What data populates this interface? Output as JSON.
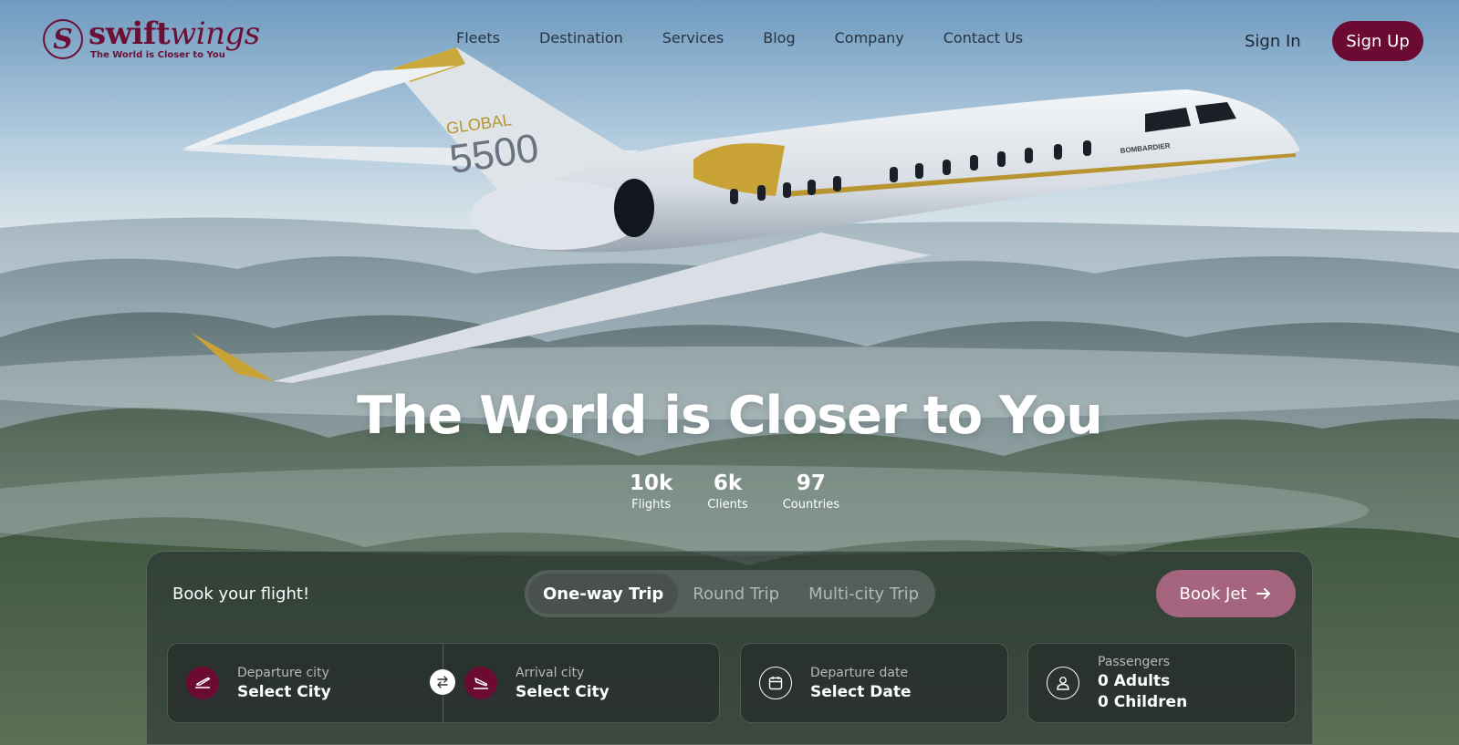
{
  "brand": {
    "name_part1": "swift",
    "name_part2": "wings",
    "tagline": "The World is Closer to You",
    "mark": "S",
    "color": "#6b0a33"
  },
  "nav": {
    "items": [
      "Fleets",
      "Destination",
      "Services",
      "Blog",
      "Company",
      "Contact Us"
    ]
  },
  "auth": {
    "sign_in": "Sign In",
    "sign_up": "Sign Up"
  },
  "hero": {
    "headline": "The World is Closer to You",
    "aircraft_model_line1": "GLOBAL",
    "aircraft_model_line2": "5500",
    "aircraft_brand": "BOMBARDIER",
    "stats": [
      {
        "value": "10k",
        "label": "Flights"
      },
      {
        "value": "6k",
        "label": "Clients"
      },
      {
        "value": "97",
        "label": "Countries"
      }
    ]
  },
  "booking": {
    "title": "Book your flight!",
    "trip_types": [
      "One-way Trip",
      "Round Trip",
      "Multi-city Trip"
    ],
    "active_trip_type": "One-way Trip",
    "book_button": "Book Jet",
    "departure": {
      "label": "Departure city",
      "value": "Select City",
      "icon": "takeoff-icon"
    },
    "arrival": {
      "label": "Arrival city",
      "value": "Select City",
      "icon": "landing-icon"
    },
    "date": {
      "label": "Departure date",
      "value": "Select Date",
      "icon": "calendar-icon"
    },
    "passengers": {
      "label": "Passengers",
      "adults": "0 Adults",
      "children": "0 Children",
      "icon": "user-icon"
    }
  }
}
